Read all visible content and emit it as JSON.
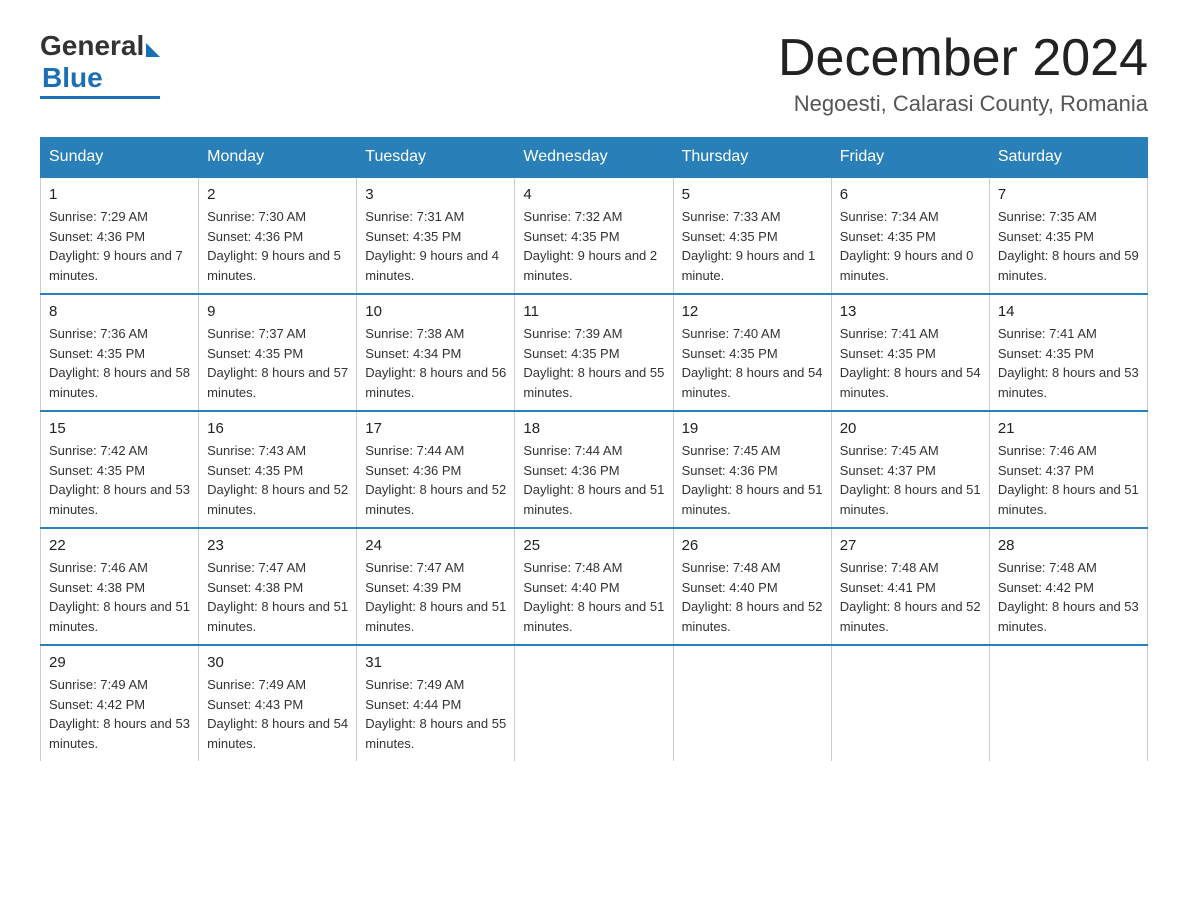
{
  "header": {
    "logo_general": "General",
    "logo_blue": "Blue",
    "month_title": "December 2024",
    "location": "Negoesti, Calarasi County, Romania"
  },
  "days_of_week": [
    "Sunday",
    "Monday",
    "Tuesday",
    "Wednesday",
    "Thursday",
    "Friday",
    "Saturday"
  ],
  "weeks": [
    [
      {
        "day": "1",
        "sunrise": "7:29 AM",
        "sunset": "4:36 PM",
        "daylight": "9 hours and 7 minutes."
      },
      {
        "day": "2",
        "sunrise": "7:30 AM",
        "sunset": "4:36 PM",
        "daylight": "9 hours and 5 minutes."
      },
      {
        "day": "3",
        "sunrise": "7:31 AM",
        "sunset": "4:35 PM",
        "daylight": "9 hours and 4 minutes."
      },
      {
        "day": "4",
        "sunrise": "7:32 AM",
        "sunset": "4:35 PM",
        "daylight": "9 hours and 2 minutes."
      },
      {
        "day": "5",
        "sunrise": "7:33 AM",
        "sunset": "4:35 PM",
        "daylight": "9 hours and 1 minute."
      },
      {
        "day": "6",
        "sunrise": "7:34 AM",
        "sunset": "4:35 PM",
        "daylight": "9 hours and 0 minutes."
      },
      {
        "day": "7",
        "sunrise": "7:35 AM",
        "sunset": "4:35 PM",
        "daylight": "8 hours and 59 minutes."
      }
    ],
    [
      {
        "day": "8",
        "sunrise": "7:36 AM",
        "sunset": "4:35 PM",
        "daylight": "8 hours and 58 minutes."
      },
      {
        "day": "9",
        "sunrise": "7:37 AM",
        "sunset": "4:35 PM",
        "daylight": "8 hours and 57 minutes."
      },
      {
        "day": "10",
        "sunrise": "7:38 AM",
        "sunset": "4:34 PM",
        "daylight": "8 hours and 56 minutes."
      },
      {
        "day": "11",
        "sunrise": "7:39 AM",
        "sunset": "4:35 PM",
        "daylight": "8 hours and 55 minutes."
      },
      {
        "day": "12",
        "sunrise": "7:40 AM",
        "sunset": "4:35 PM",
        "daylight": "8 hours and 54 minutes."
      },
      {
        "day": "13",
        "sunrise": "7:41 AM",
        "sunset": "4:35 PM",
        "daylight": "8 hours and 54 minutes."
      },
      {
        "day": "14",
        "sunrise": "7:41 AM",
        "sunset": "4:35 PM",
        "daylight": "8 hours and 53 minutes."
      }
    ],
    [
      {
        "day": "15",
        "sunrise": "7:42 AM",
        "sunset": "4:35 PM",
        "daylight": "8 hours and 53 minutes."
      },
      {
        "day": "16",
        "sunrise": "7:43 AM",
        "sunset": "4:35 PM",
        "daylight": "8 hours and 52 minutes."
      },
      {
        "day": "17",
        "sunrise": "7:44 AM",
        "sunset": "4:36 PM",
        "daylight": "8 hours and 52 minutes."
      },
      {
        "day": "18",
        "sunrise": "7:44 AM",
        "sunset": "4:36 PM",
        "daylight": "8 hours and 51 minutes."
      },
      {
        "day": "19",
        "sunrise": "7:45 AM",
        "sunset": "4:36 PM",
        "daylight": "8 hours and 51 minutes."
      },
      {
        "day": "20",
        "sunrise": "7:45 AM",
        "sunset": "4:37 PM",
        "daylight": "8 hours and 51 minutes."
      },
      {
        "day": "21",
        "sunrise": "7:46 AM",
        "sunset": "4:37 PM",
        "daylight": "8 hours and 51 minutes."
      }
    ],
    [
      {
        "day": "22",
        "sunrise": "7:46 AM",
        "sunset": "4:38 PM",
        "daylight": "8 hours and 51 minutes."
      },
      {
        "day": "23",
        "sunrise": "7:47 AM",
        "sunset": "4:38 PM",
        "daylight": "8 hours and 51 minutes."
      },
      {
        "day": "24",
        "sunrise": "7:47 AM",
        "sunset": "4:39 PM",
        "daylight": "8 hours and 51 minutes."
      },
      {
        "day": "25",
        "sunrise": "7:48 AM",
        "sunset": "4:40 PM",
        "daylight": "8 hours and 51 minutes."
      },
      {
        "day": "26",
        "sunrise": "7:48 AM",
        "sunset": "4:40 PM",
        "daylight": "8 hours and 52 minutes."
      },
      {
        "day": "27",
        "sunrise": "7:48 AM",
        "sunset": "4:41 PM",
        "daylight": "8 hours and 52 minutes."
      },
      {
        "day": "28",
        "sunrise": "7:48 AM",
        "sunset": "4:42 PM",
        "daylight": "8 hours and 53 minutes."
      }
    ],
    [
      {
        "day": "29",
        "sunrise": "7:49 AM",
        "sunset": "4:42 PM",
        "daylight": "8 hours and 53 minutes."
      },
      {
        "day": "30",
        "sunrise": "7:49 AM",
        "sunset": "4:43 PM",
        "daylight": "8 hours and 54 minutes."
      },
      {
        "day": "31",
        "sunrise": "7:49 AM",
        "sunset": "4:44 PM",
        "daylight": "8 hours and 55 minutes."
      },
      null,
      null,
      null,
      null
    ]
  ],
  "labels": {
    "sunrise": "Sunrise:",
    "sunset": "Sunset:",
    "daylight": "Daylight:"
  },
  "colors": {
    "header_bg": "#2980b9",
    "accent_blue": "#1a6fb5"
  }
}
